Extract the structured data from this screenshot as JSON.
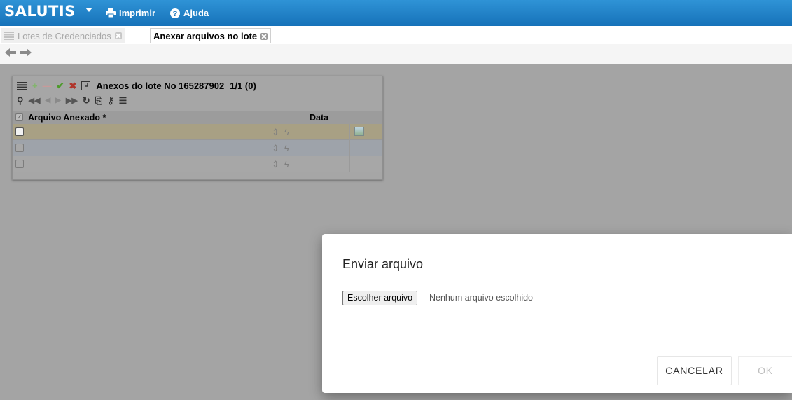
{
  "header": {
    "app_name": "SALUTIS",
    "print_label": "Imprimir",
    "help_label": "Ajuda"
  },
  "tabs": [
    {
      "label": "Lotes de Credenciados",
      "active": false
    },
    {
      "label": "Anexar arquivos no lote",
      "active": true
    }
  ],
  "panel": {
    "title": "Anexos do lote No 165287902",
    "count": "1/1 (0)",
    "columns": [
      "Arquivo Anexado *",
      "Data"
    ],
    "rows": [
      {
        "arquivo": "",
        "data": "",
        "selected": true
      },
      {
        "arquivo": "",
        "data": "",
        "selected": false
      },
      {
        "arquivo": "",
        "data": "",
        "selected": false
      }
    ]
  },
  "dialog": {
    "title": "Enviar arquivo",
    "choose_button": "Escolher arquivo",
    "no_file_text": "Nenhum arquivo escolhido",
    "cancel_label": "CANCELAR",
    "ok_label": "OK"
  },
  "colors": {
    "header_blue": "#1a78be",
    "overlay_gray": "#a4a4a4",
    "add_green": "#7fbf5a",
    "remove_red": "#d0352a"
  }
}
